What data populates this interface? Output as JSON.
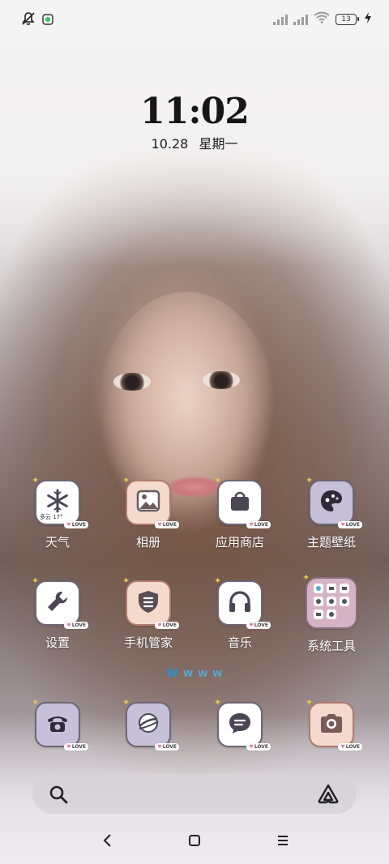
{
  "status_bar": {
    "battery_level": "13",
    "icons": [
      "mute-icon",
      "app-notification-icon",
      "signal-sim1-icon",
      "signal-sim2-icon",
      "wifi-icon",
      "battery-icon",
      "charging-icon"
    ]
  },
  "lockscreen": {
    "time": "11:02",
    "date": "10.28",
    "weekday": "星期一"
  },
  "apps_row1": [
    {
      "label": "天气",
      "icon": "snowflake-icon",
      "subtext": "多云 17°"
    },
    {
      "label": "相册",
      "icon": "gallery-icon"
    },
    {
      "label": "应用商店",
      "icon": "shopping-bag-icon"
    },
    {
      "label": "主题壁纸",
      "icon": "palette-icon"
    }
  ],
  "apps_row2": [
    {
      "label": "设置",
      "icon": "wrench-icon"
    },
    {
      "label": "手机管家",
      "icon": "shield-icon"
    },
    {
      "label": "音乐",
      "icon": "headphones-icon"
    },
    {
      "label": "系统工具",
      "icon": "folder-icon"
    }
  ],
  "dock": [
    {
      "name": "phone",
      "icon": "phone-icon"
    },
    {
      "name": "browser",
      "icon": "planet-icon"
    },
    {
      "name": "messages",
      "icon": "message-icon"
    },
    {
      "name": "camera",
      "icon": "camera-icon"
    }
  ],
  "tag": {
    "love": "LOVE"
  },
  "page_indicator": {
    "glyph": "W",
    "count": 4,
    "active": 0
  },
  "search_bar": {
    "left_icon": "search-icon",
    "right_icon": "assistant-icon"
  },
  "nav_bar": {
    "icons": [
      "back-icon",
      "home-icon",
      "menu-icon"
    ]
  },
  "colors": {
    "tile_border": "#6d6775",
    "lavender": "#c6c1d8",
    "peach": "#f4d9cd",
    "indicator": "#2f8fc9"
  }
}
